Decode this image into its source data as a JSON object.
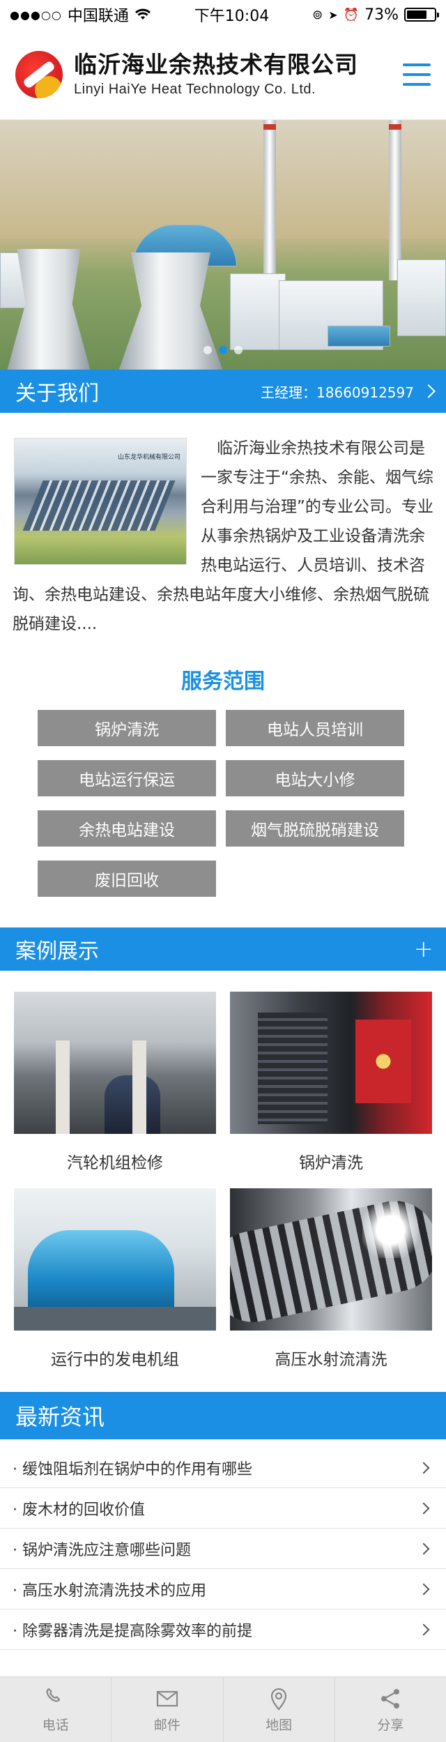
{
  "status_bar": {
    "carrier": "中国联通",
    "time": "下午10:04",
    "battery": "73%",
    "battery_level": 0.73
  },
  "header": {
    "company_cn": "临沂海业余热技术有限公司",
    "company_en": "Linyi HaiYe Heat Technology Co. Ltd."
  },
  "banner": {
    "slide_count": 3,
    "active_slide": 2
  },
  "about": {
    "title": "关于我们",
    "contact": "王经理：18660912597",
    "image_caption": "山东龙华机械有限公司",
    "text": "临沂海业余热技术有限公司是一家专注于“余热、余能、烟气综合利用与治理”的专业公司。专业从事余热锅炉及工业设备清洗余热电站运行、人员培训、技术咨询、余热电站建设、余热电站年度大小维修、余热烟气脱硫脱硝建设...."
  },
  "services": {
    "title": "服务范围",
    "items": [
      "锅炉清洗",
      "电站人员培训",
      "电站运行保运",
      "电站大小修",
      "余热电站建设",
      "烟气脱硫脱硝建设",
      "废旧回收"
    ]
  },
  "cases": {
    "title": "案例展示",
    "more": "+",
    "items": [
      "汽轮机组检修",
      "锅炉清洗",
      "运行中的发电机组",
      "高压水射流清洗"
    ]
  },
  "news": {
    "title": "最新资讯",
    "items": [
      "· 缓蚀阻垢剂在锅炉中的作用有哪些",
      "· 废木材的回收价值",
      "· 锅炉清洗应注意哪些问题",
      "· 高压水射流清洗技术的应用",
      "· 除雾器清洗是提高除雾效率的前提"
    ]
  },
  "bottom_nav": {
    "items": [
      {
        "label": "电话",
        "icon": "phone-icon"
      },
      {
        "label": "邮件",
        "icon": "mail-icon"
      },
      {
        "label": "地图",
        "icon": "map-pin-icon"
      },
      {
        "label": "分享",
        "icon": "share-icon"
      }
    ]
  },
  "colors": {
    "accent": "#1a8fe3",
    "service_button": "#8e8e8e",
    "nav_bg": "#e9e9e9"
  }
}
